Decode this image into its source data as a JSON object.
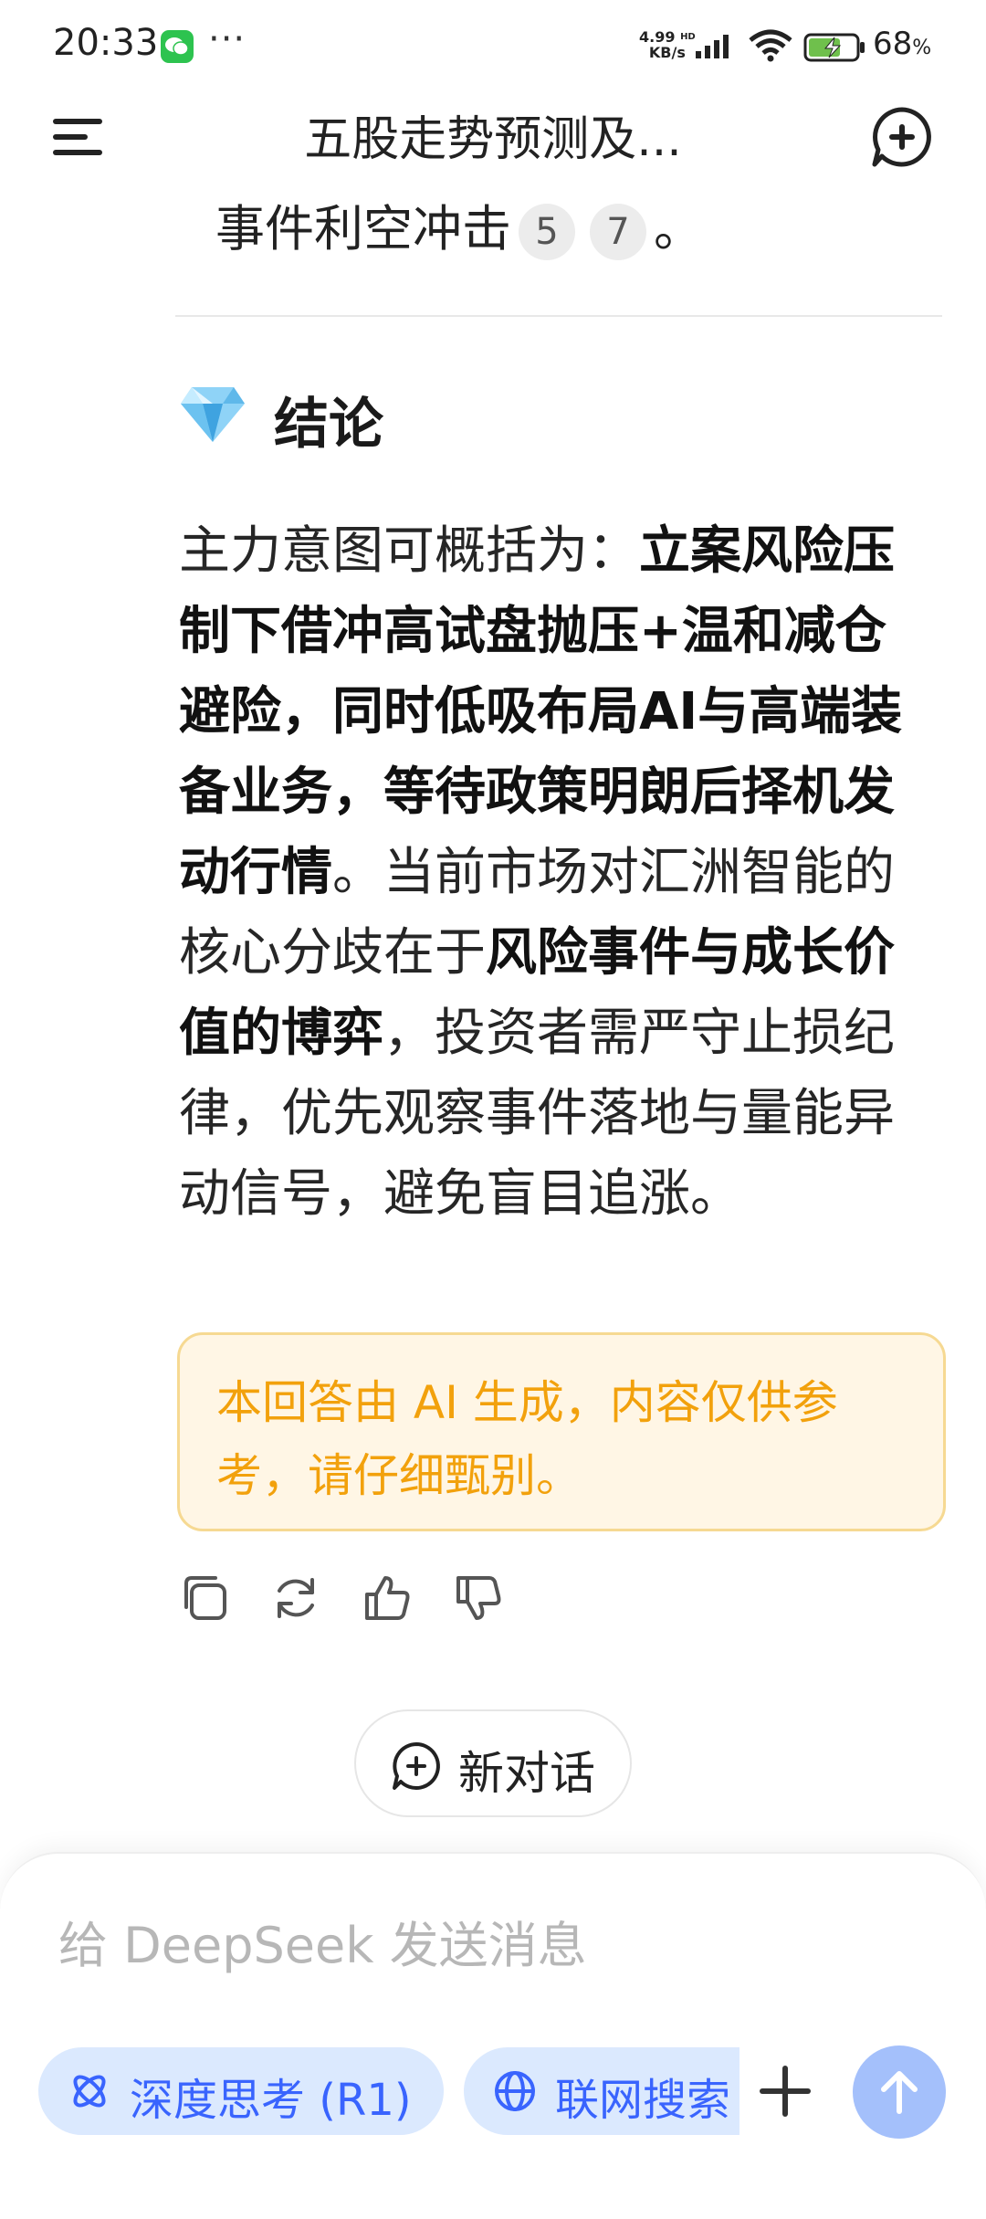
{
  "status_bar": {
    "time": "20:33",
    "dots": "···",
    "net_speed_value": "4.99",
    "net_speed_unit": "KB/s",
    "hd": "HD",
    "battery": "68",
    "battery_unit": "%"
  },
  "header": {
    "title": "五股走势预测及..."
  },
  "content": {
    "prev_text": "事件利空冲击",
    "citations": [
      "5",
      "7"
    ],
    "prev_tail": "。",
    "section_title": "结论",
    "paragraph": [
      {
        "text": "主力意图可概括为：",
        "bold": false
      },
      {
        "text": "立案风险压制下借冲高试盘抛压+温和减仓避险，同时低吸布局AI与高端装备业务，等待政策明朗后择机发动行情",
        "bold": true
      },
      {
        "text": "。当前市场对汇洲智能的核心分歧在于",
        "bold": false
      },
      {
        "text": "风险事件与成长价值的博弈",
        "bold": true
      },
      {
        "text": "，投资者需严守止损纪律，优先观察事件落地与量能异动信号，避免盲目追涨。",
        "bold": false
      }
    ],
    "disclaimer": "本回答由 AI 生成，内容仅供参考，请仔细甄别。"
  },
  "actions": [
    "copy-icon",
    "regenerate-icon",
    "thumbs-up-icon",
    "thumbs-down-icon"
  ],
  "new_conversation": {
    "label": "新对话"
  },
  "composer": {
    "placeholder": "给 DeepSeek 发送消息",
    "deep_think_label": "深度思考 (R1)",
    "web_search_label": "联网搜索"
  },
  "colors": {
    "accent": "#3964fe",
    "chip_bg": "#dbe9fe",
    "send_button": "#a4c0fb",
    "disclaimer_text": "#f2a10c",
    "disclaimer_bg": "#fff6e5"
  }
}
